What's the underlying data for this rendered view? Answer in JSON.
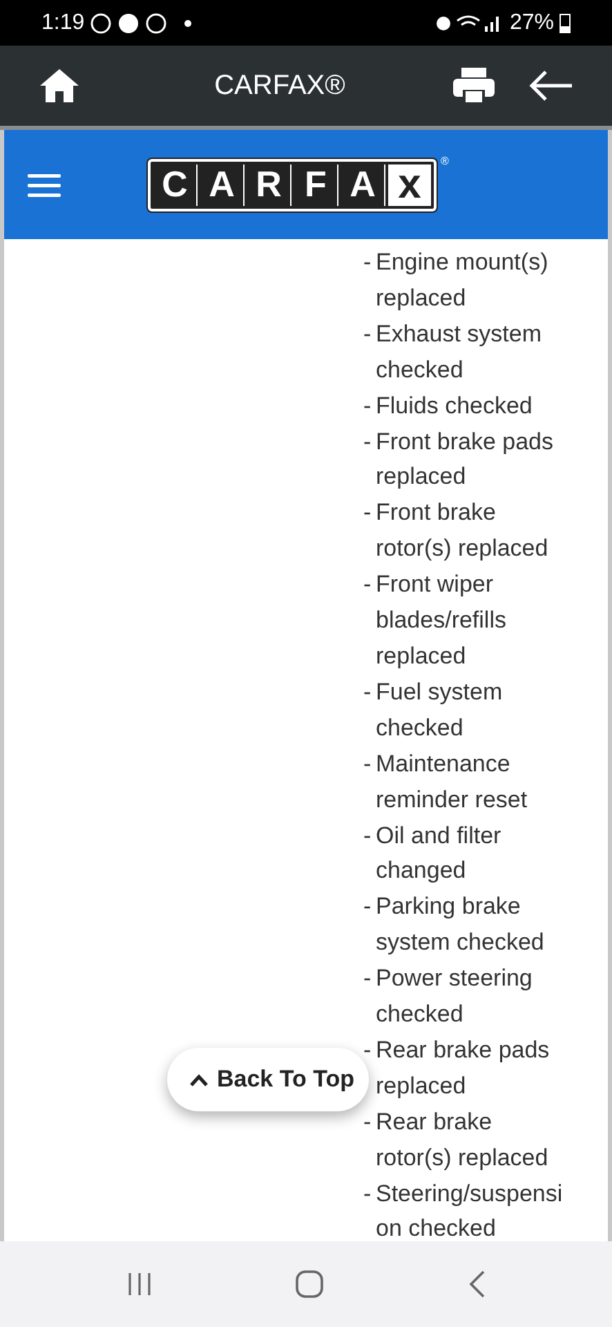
{
  "status_bar": {
    "time": "1:19",
    "battery": "27%"
  },
  "app_bar": {
    "title": "CARFAX®"
  },
  "header": {
    "logo_letters": [
      "C",
      "A",
      "R",
      "F",
      "A",
      "x"
    ],
    "logo_mark": "®"
  },
  "items": [
    {
      "text": "Engine mount(s) replaced"
    },
    {
      "text": "Exhaust system checked"
    },
    {
      "text": "Fluids checked"
    },
    {
      "text": "Front brake pads replaced"
    },
    {
      "text": "Front brake rotor(s) replaced"
    },
    {
      "text": "Front wiper blades/refills replaced"
    },
    {
      "text": "Fuel system checked"
    },
    {
      "text": "Maintenance reminder reset"
    },
    {
      "text": "Oil and filter changed"
    },
    {
      "text": "Parking brake system checked"
    },
    {
      "text": "Power steering checked"
    },
    {
      "text": "Rear brake pads replaced"
    },
    {
      "text": "Rear brake rotor(s) replaced"
    },
    {
      "text": "Steering/suspension checked"
    }
  ],
  "item_dash": "-",
  "back_to_top": {
    "label": "Back To Top"
  }
}
